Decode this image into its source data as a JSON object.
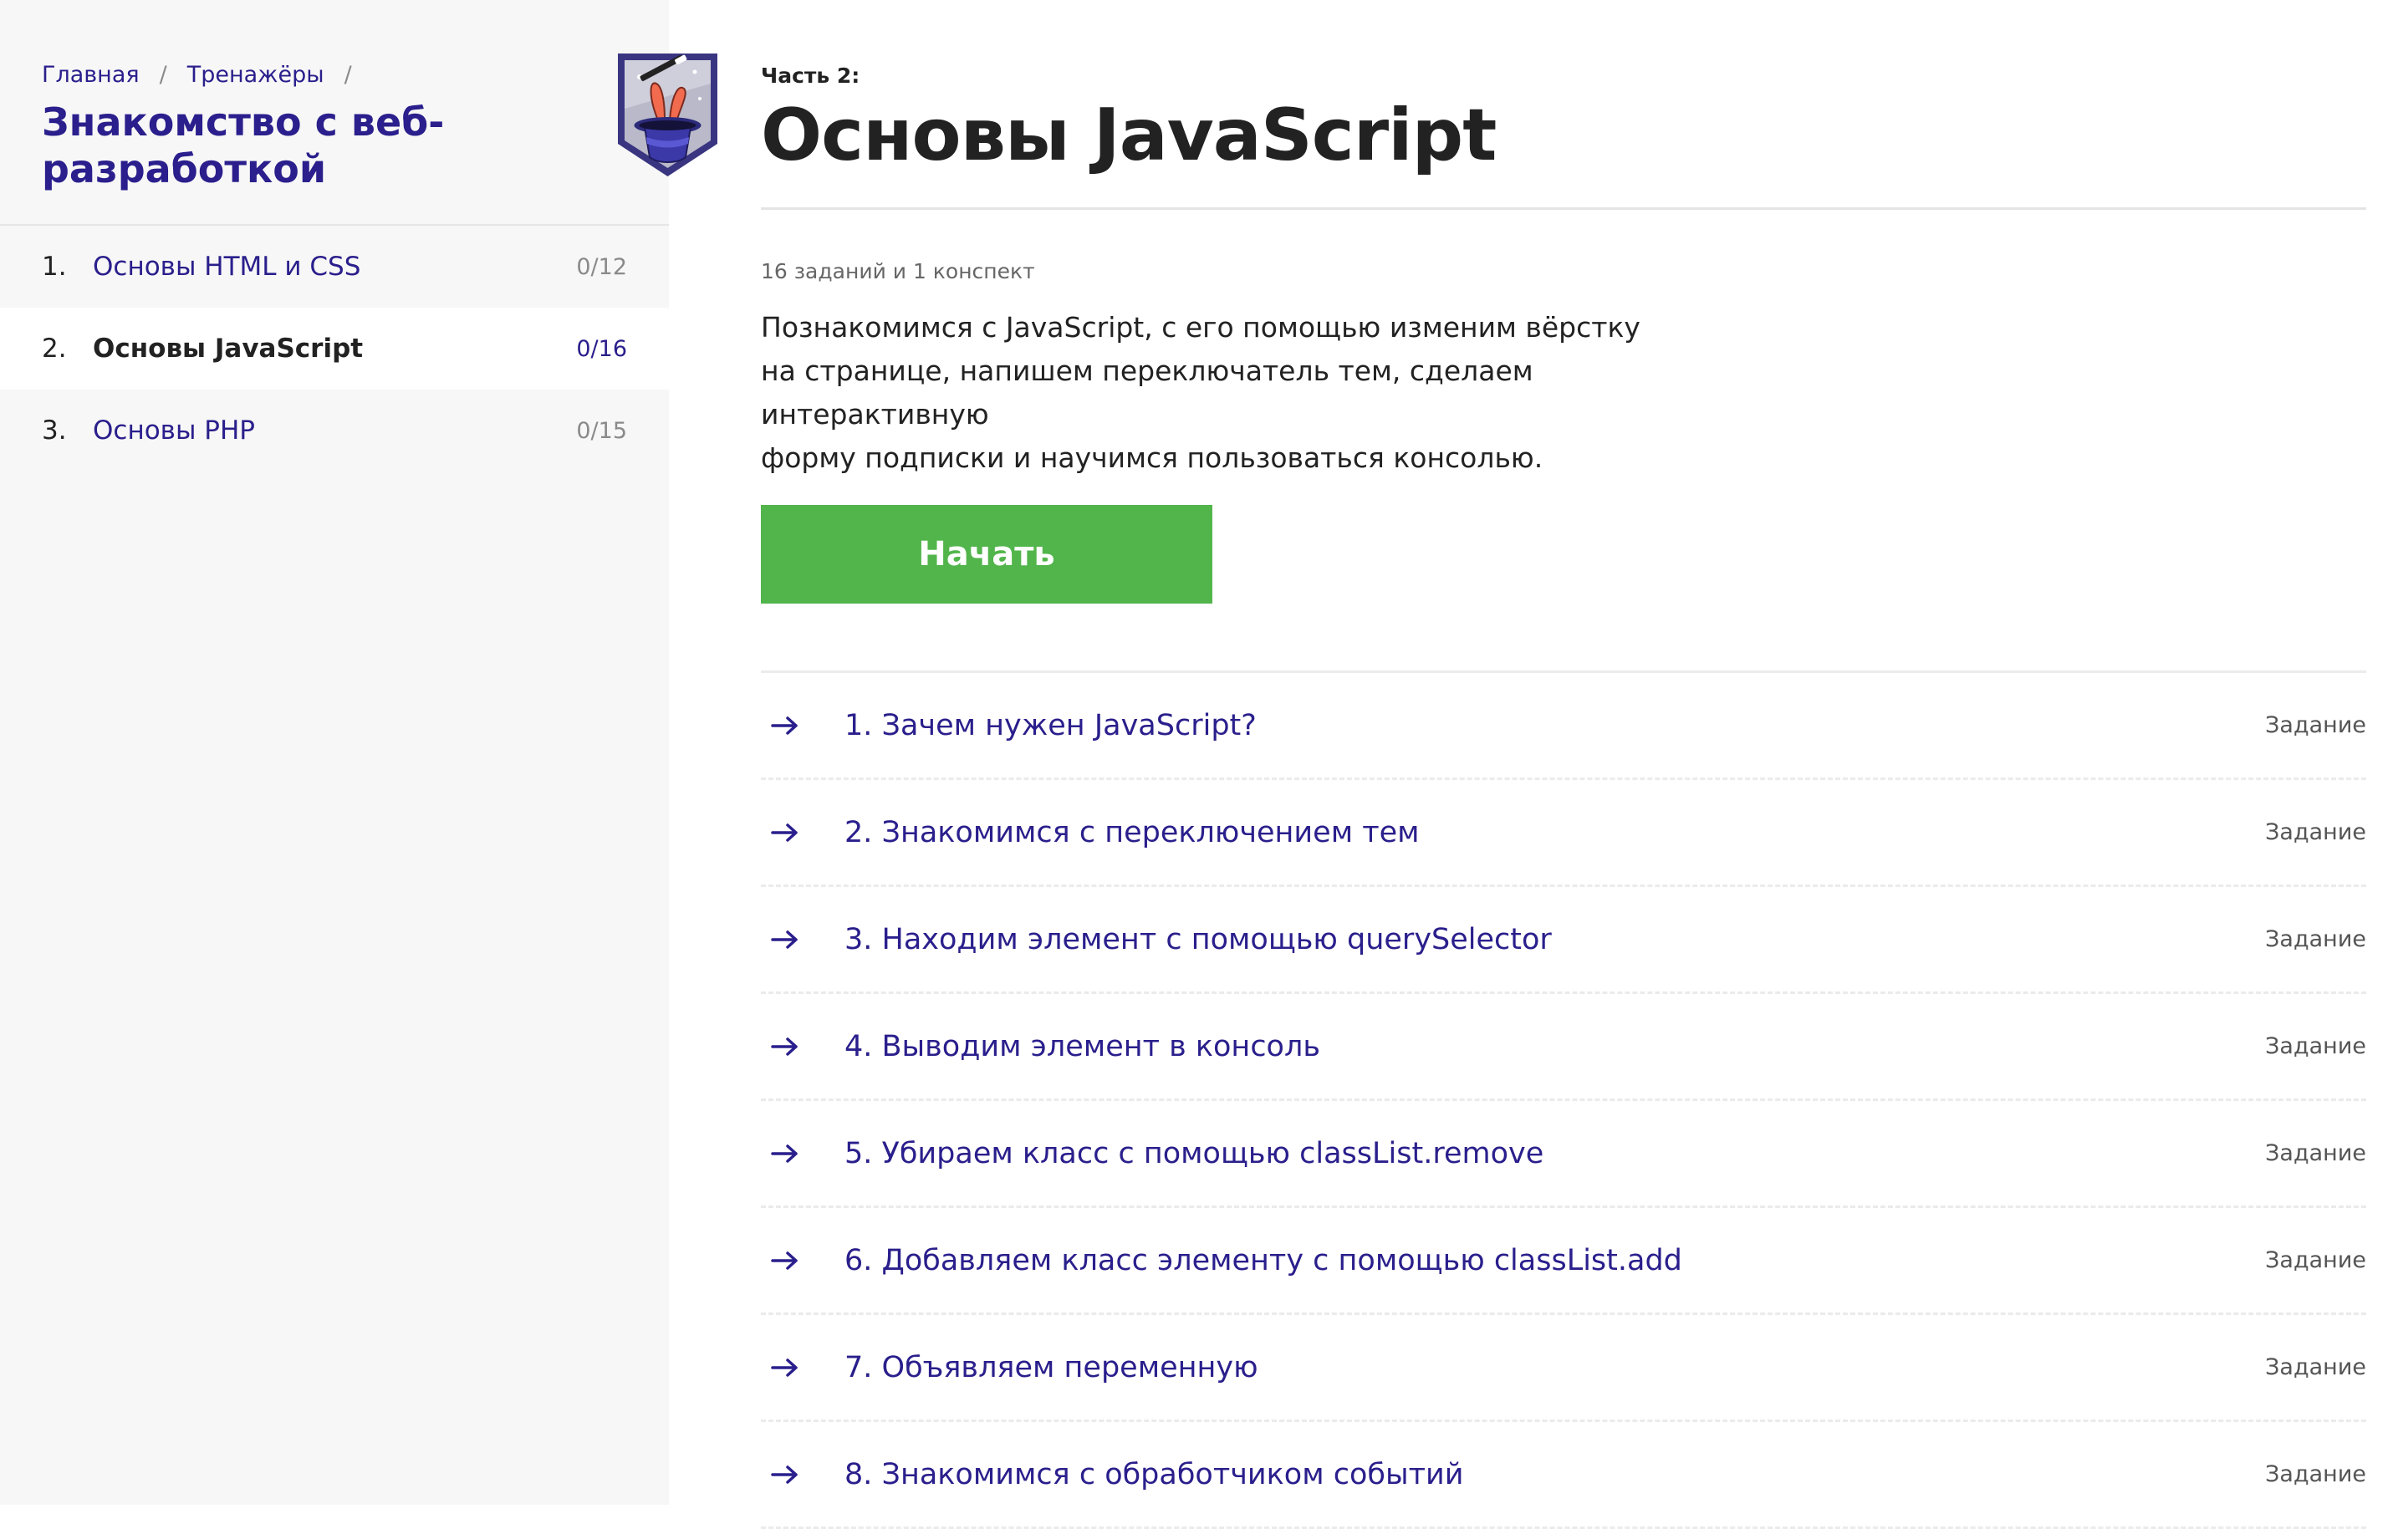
{
  "sidebar": {
    "breadcrumb": [
      {
        "label": "Главная"
      },
      {
        "label": "Тренажёры"
      }
    ],
    "breadcrumb_separator": "/",
    "course_title": "Знакомство с веб-разработкой",
    "badge_icon": "magic-hat-rabbit-icon",
    "items": [
      {
        "num": "1.",
        "label": "Основы HTML и CSS",
        "count": "0/12",
        "active": false
      },
      {
        "num": "2.",
        "label": "Основы JavaScript",
        "count": "0/16",
        "active": true
      },
      {
        "num": "3.",
        "label": "Основы PHP",
        "count": "0/15",
        "active": false
      }
    ]
  },
  "main": {
    "part_label": "Часть 2:",
    "title": "Основы JavaScript",
    "summary": "16 заданий и 1 конспект",
    "description_lines": [
      "Познакомимся с JavaScript, с его помощью изменим вёрстку",
      "на странице, напишем переключатель тем, сделаем интерактивную",
      "форму подписки и научимся пользоваться консолью."
    ],
    "start_button": "Начать",
    "tasks": [
      {
        "title": "1. Зачем нужен JavaScript?",
        "type": "Задание"
      },
      {
        "title": "2. Знакомимся с переключением тем",
        "type": "Задание"
      },
      {
        "title": "3. Находим элемент с помощью querySelector",
        "type": "Задание"
      },
      {
        "title": "4. Выводим элемент в консоль",
        "type": "Задание"
      },
      {
        "title": "5. Убираем класс с помощью classList.remove",
        "type": "Задание"
      },
      {
        "title": "6. Добавляем класс элементу с помощью classList.add",
        "type": "Задание"
      },
      {
        "title": "7. Объявляем переменную",
        "type": "Задание"
      },
      {
        "title": "8. Знакомимся с обработчиком событий",
        "type": "Задание"
      }
    ]
  },
  "colors": {
    "accent": "#2a1f8c",
    "button": "#52b54b",
    "sidebar_bg": "#f7f7f7"
  }
}
